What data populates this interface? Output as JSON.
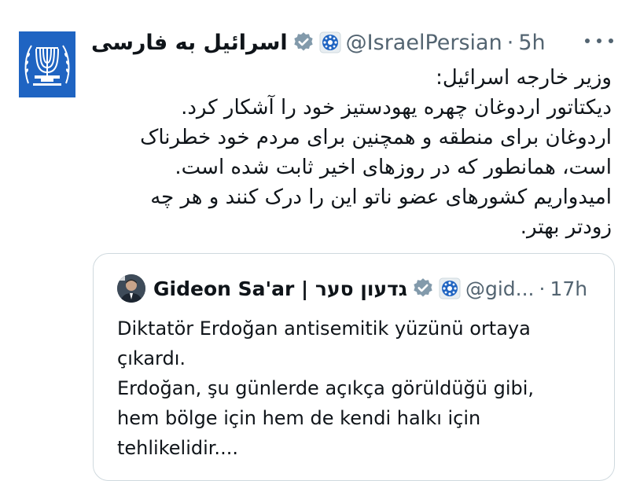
{
  "colors": {
    "verified_badge": "#829aab",
    "avatar_background": "#1f64c2",
    "muted_text": "#536471",
    "border": "#cfd9de"
  },
  "tweet": {
    "author_name": "اسرائیل به فارسی",
    "handle": "@IsraelPersian",
    "separator": "·",
    "time": "5h",
    "avatar_icon": "israel-emblem-menorah",
    "lines": [
      "وزیر خارجه اسرائیل:",
      "دیکتاتور اردوغان چهره یهودستیز خود را آشکار کرد.",
      "اردوغان برای منطقه و همچنین برای مردم خود خطرناک",
      "است، همانطور که در روزهای اخیر ثابت شده است.",
      "امیدواریم کشورهای عضو ناتو این را درک کنند و هر چه",
      "زودتر بهتر."
    ]
  },
  "quoted_tweet": {
    "author_name": "Gideon Sa'ar | גדעון סער",
    "handle": "@gid...",
    "separator": "·",
    "time": "17h",
    "lines": [
      "Diktatör Erdoğan antisemitik yüzünü ortaya",
      "çıkardı.",
      "Erdoğan, şu günlerde açıkça görüldüğü gibi,",
      "hem bölge için hem de kendi halkı için",
      "tehlikelidir...."
    ]
  }
}
